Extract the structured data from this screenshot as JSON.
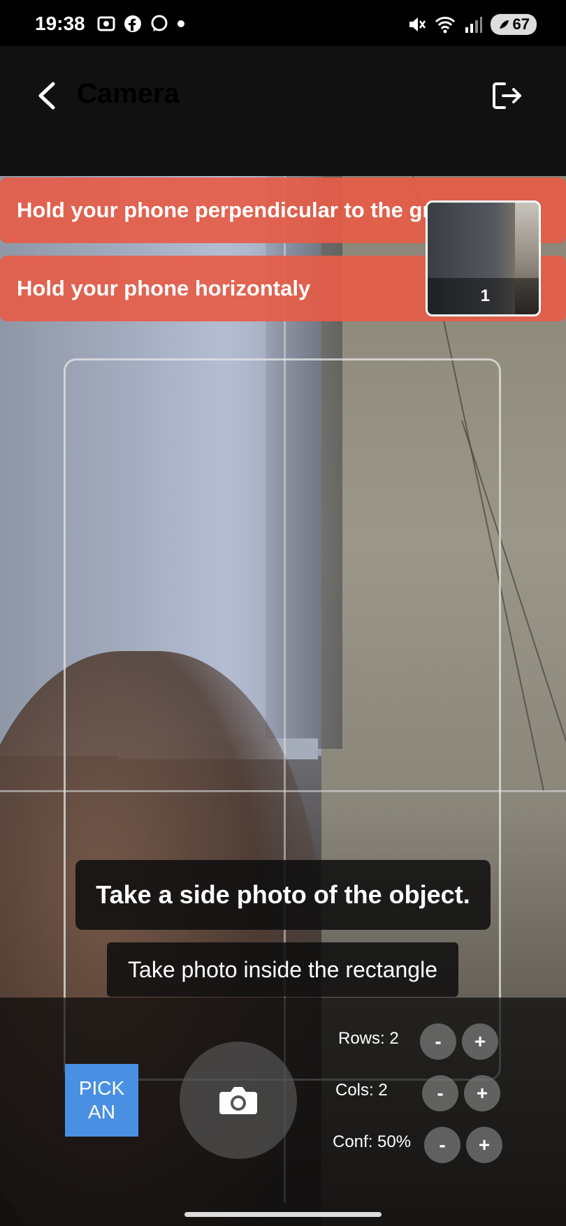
{
  "status_bar": {
    "time": "19:38",
    "battery": "67",
    "left_icons": [
      "screenshot-icon",
      "facebook-icon",
      "whatsapp-icon",
      "dot-icon"
    ],
    "right_icons": [
      "mute-icon",
      "wifi-icon",
      "signal-icon",
      "battery-icon"
    ]
  },
  "app_bar": {
    "title": "Camera",
    "back_icon": "chevron-left-icon",
    "logout_icon": "logout-icon"
  },
  "warnings": [
    "Hold your phone perpendicular to the ground",
    "Hold your phone horizontaly"
  ],
  "thumbnail": {
    "count": "1"
  },
  "hints": {
    "main": "Take a side photo of the object.",
    "sub": "Take photo inside the rectangle"
  },
  "controls": {
    "pick_label_line1": "PICK",
    "pick_label_line2": "AN",
    "rows_label": "Rows: 2",
    "cols_label": "Cols: 2",
    "conf_label": "Conf: 50%",
    "minus": "-",
    "plus": "+"
  },
  "colors": {
    "warning_bg": "#e65c48",
    "pick_button_bg": "#4a90e2",
    "app_bar_bg": "#111111"
  }
}
